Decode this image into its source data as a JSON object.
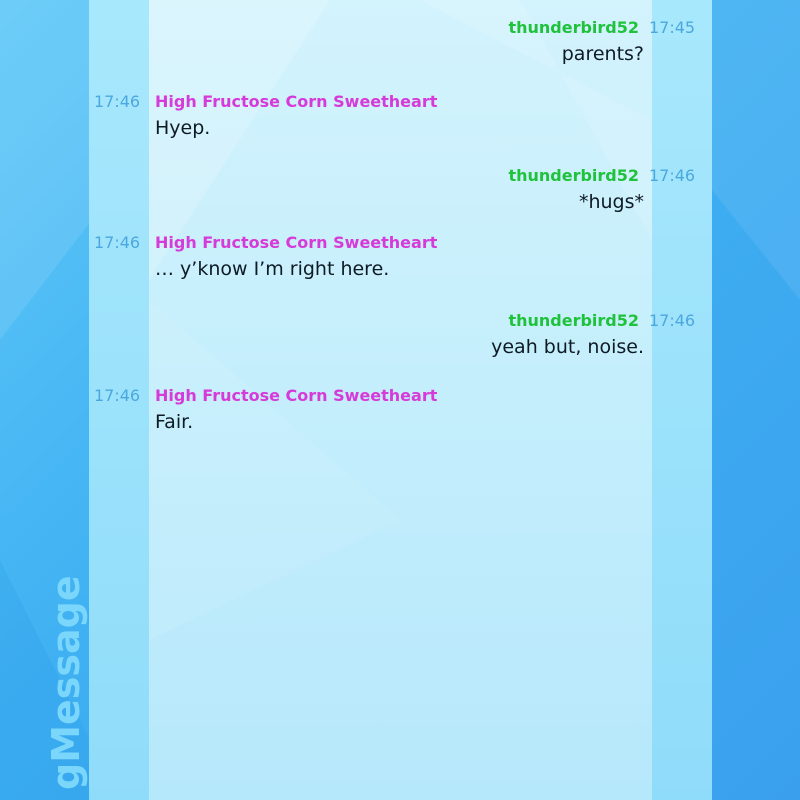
{
  "app": {
    "brand": "gMessage"
  },
  "colors": {
    "self_name": "#1fc23a",
    "other_name": "#d63ad8",
    "timestamp": "#4aa8e0",
    "background": "#3fb0f2"
  },
  "messages": [
    {
      "side": "right",
      "sender": "thunderbird52",
      "time": "17:45",
      "text": "parents?"
    },
    {
      "side": "left",
      "sender": "High Fructose Corn Sweetheart",
      "time": "17:46",
      "text": "Hyep."
    },
    {
      "side": "right",
      "sender": "thunderbird52",
      "time": "17:46",
      "text": "*hugs*"
    },
    {
      "side": "left",
      "sender": "High Fructose Corn Sweetheart",
      "time": "17:46",
      "text": "… y’know I’m right here."
    },
    {
      "side": "right",
      "sender": "thunderbird52",
      "time": "17:46",
      "text": "yeah but, noise."
    },
    {
      "side": "left",
      "sender": "High Fructose Corn Sweetheart",
      "time": "17:46",
      "text": "Fair."
    }
  ]
}
